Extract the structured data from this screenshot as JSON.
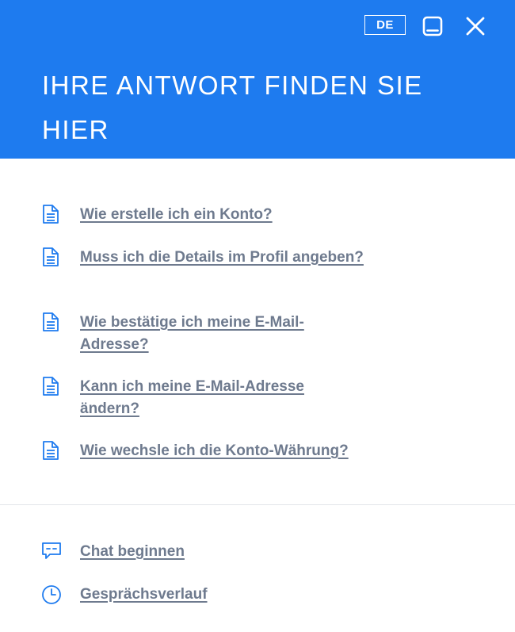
{
  "colors": {
    "accent": "#1E7BEF",
    "link": "#6E7A8E",
    "icon": "#1E7BEF"
  },
  "header": {
    "language": "DE",
    "title": "IHRE ANTWORT FINDEN SIE HIER",
    "minimize_icon": "minimize-icon",
    "close_icon": "close-icon"
  },
  "faq": {
    "items": [
      {
        "label": "Wie erstelle ich ein Konto?",
        "icon": "document-icon"
      },
      {
        "label": "Muss ich die Details im Profil angeben?",
        "icon": "document-icon"
      },
      {
        "label": "Wie bestätige ich meine E-Mail-Adresse?",
        "icon": "document-icon"
      },
      {
        "label": "Kann ich meine E-Mail-Adresse ändern?",
        "icon": "document-icon"
      },
      {
        "label": "Wie wechsle ich die Konto-Währung?",
        "icon": "document-icon"
      }
    ]
  },
  "footer": {
    "chat_label": "Chat beginnen",
    "chat_icon": "chat-icon",
    "history_label": "Gesprächsverlauf",
    "history_icon": "clock-icon"
  }
}
